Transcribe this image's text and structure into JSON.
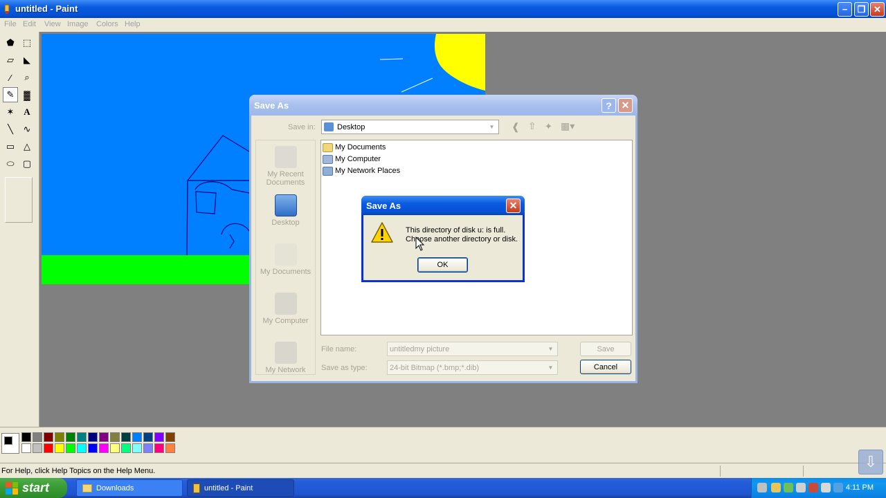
{
  "window": {
    "title": "untitled - Paint",
    "controls": {
      "minimize": "−",
      "restore": "❐",
      "close": "✕"
    }
  },
  "menu": [
    "File",
    "Edit",
    "View",
    "Image",
    "Colors",
    "Help"
  ],
  "tools": [
    {
      "name": "free-select",
      "glyph": "⬟"
    },
    {
      "name": "rect-select",
      "glyph": "⬚"
    },
    {
      "name": "eraser",
      "glyph": "▱"
    },
    {
      "name": "fill-bucket",
      "glyph": "◣"
    },
    {
      "name": "color-picker",
      "glyph": "∕"
    },
    {
      "name": "magnifier",
      "glyph": "⌕"
    },
    {
      "name": "pencil",
      "glyph": "✎",
      "selected": true
    },
    {
      "name": "brush",
      "glyph": "▓"
    },
    {
      "name": "airbrush",
      "glyph": "✶"
    },
    {
      "name": "text",
      "glyph": "A"
    },
    {
      "name": "line",
      "glyph": "╲"
    },
    {
      "name": "curve",
      "glyph": "∿"
    },
    {
      "name": "rectangle",
      "glyph": "▭"
    },
    {
      "name": "polygon",
      "glyph": "△"
    },
    {
      "name": "ellipse",
      "glyph": "⬭"
    },
    {
      "name": "rounded-rectangle",
      "glyph": "▢"
    }
  ],
  "palette": {
    "top": [
      "#000000",
      "#808080",
      "#800000",
      "#808000",
      "#008000",
      "#008080",
      "#000080",
      "#800080",
      "#808040",
      "#004040",
      "#0080ff",
      "#004080",
      "#8000ff",
      "#804000"
    ],
    "bottom": [
      "#ffffff",
      "#c0c0c0",
      "#ff0000",
      "#ffff00",
      "#00ff00",
      "#00ffff",
      "#0000ff",
      "#ff00ff",
      "#ffff80",
      "#00ff80",
      "#80ffff",
      "#8080ff",
      "#ff0080",
      "#ff8040"
    ],
    "foreground": "#000000",
    "background": "#ffffff"
  },
  "status": {
    "text": "For Help, click Help Topics on the Help Menu."
  },
  "taskbar": {
    "start_label": "start",
    "tasks": [
      {
        "label": "Downloads",
        "icon": "folder-icon"
      },
      {
        "label": "untitled - Paint",
        "icon": "paint-icon"
      }
    ],
    "clock": "4:11 PM"
  },
  "save_dialog": {
    "title": "Save As",
    "help": "?",
    "close": "✕",
    "save_in_label": "Save in:",
    "save_in_value": "Desktop",
    "places": [
      "My Recent Documents",
      "Desktop",
      "My Documents",
      "My Computer",
      "My Network"
    ],
    "files": [
      "My Documents",
      "My Computer",
      "My Network Places"
    ],
    "file_name_label": "File name:",
    "file_name_value": "untitledmy picture",
    "save_type_label": "Save as type:",
    "save_type_value": "24-bit Bitmap (*.bmp;*.dib)",
    "save_button": "Save",
    "cancel_button": "Cancel"
  },
  "message_box": {
    "title": "Save As",
    "close": "✕",
    "line1": "This directory of disk u: is full.",
    "line2": "Choose another directory or disk.",
    "ok": "OK"
  },
  "colors": {
    "canvas_sky": "#0080ff",
    "canvas_grass": "#00ff00",
    "canvas_sun": "#ffff00"
  }
}
